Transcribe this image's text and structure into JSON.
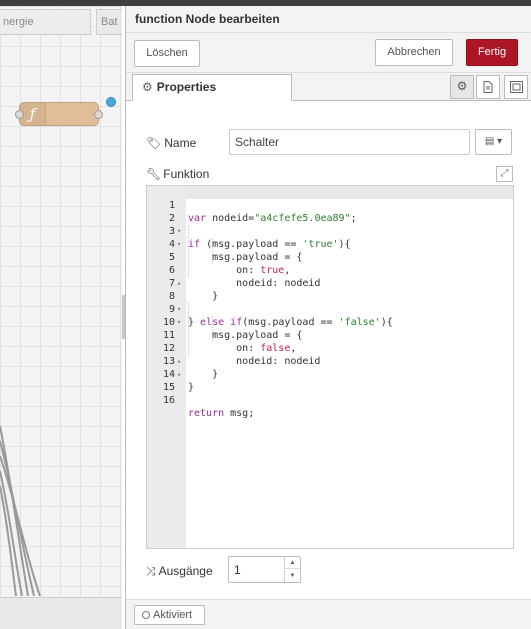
{
  "workspace": {
    "tabs": [
      {
        "label": "nergie"
      },
      {
        "label": "Bat"
      }
    ],
    "node": {
      "icon": "function-icon",
      "color": "#e2be98"
    }
  },
  "tray": {
    "title": "function Node bearbeiten",
    "buttons": {
      "delete": "Löschen",
      "cancel": "Abbrechen",
      "done": "Fertig"
    },
    "tabs": [
      {
        "label": "Properties",
        "icon": "gear-icon"
      }
    ],
    "side_buttons": [
      "gear-icon",
      "document-icon",
      "appearance-icon"
    ],
    "accent_color": "#ad1625"
  },
  "form": {
    "name_label": "Name",
    "name_value": "Schalter",
    "function_label": "Funktion",
    "outputs_label": "Ausgänge",
    "outputs_value": "1"
  },
  "code": {
    "lines": [
      {
        "n": "1",
        "fold": ""
      },
      {
        "n": "2",
        "fold": ""
      },
      {
        "n": "3",
        "fold": "▾"
      },
      {
        "n": "4",
        "fold": "▾"
      },
      {
        "n": "5",
        "fold": ""
      },
      {
        "n": "6",
        "fold": ""
      },
      {
        "n": "7",
        "fold": "▴"
      },
      {
        "n": "8",
        "fold": ""
      },
      {
        "n": "9",
        "fold": "▾"
      },
      {
        "n": "10",
        "fold": "▾"
      },
      {
        "n": "11",
        "fold": ""
      },
      {
        "n": "12",
        "fold": ""
      },
      {
        "n": "13",
        "fold": "▴"
      },
      {
        "n": "14",
        "fold": "▴"
      },
      {
        "n": "15",
        "fold": ""
      },
      {
        "n": "16",
        "fold": ""
      }
    ],
    "tokens": {
      "l1_kw": "var",
      "l1_a": " nodeid=",
      "l1_str": "\"a4cfefe5.0ea89\"",
      "l1_b": ";",
      "l3_kw": "if",
      "l3_a": " (msg.payload == ",
      "l3_str": "'true'",
      "l3_b": "){",
      "l4": "    msg.payload = {",
      "l5_a": "        on: ",
      "l5_bool": "true",
      "l5_b": ",",
      "l6": "        nodeid: nodeid",
      "l7": "    }",
      "l9_a": "} ",
      "l9_kw1": "else",
      "l9_b": " ",
      "l9_kw2": "if",
      "l9_c": "(msg.payload == ",
      "l9_str": "'false'",
      "l9_d": "){",
      "l10": "    msg.payload = {",
      "l11_a": "        on: ",
      "l11_bool": "false",
      "l11_b": ",",
      "l12": "        nodeid: nodeid",
      "l13": "    }",
      "l14": "}",
      "l16_kw": "return",
      "l16_a": " msg;"
    }
  },
  "footer": {
    "enabled_label": "Aktiviert"
  }
}
